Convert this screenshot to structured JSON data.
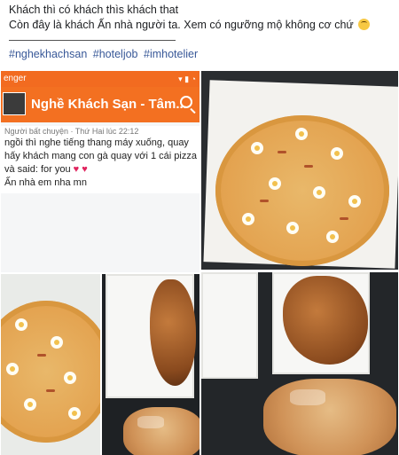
{
  "post": {
    "line1": "Khách thì có khách thìs khách that",
    "line2": "Còn đây là khách Ấn nhà người ta. Xem có ngưỡng mộ không cơ chứ",
    "hashtags": [
      "#nghekhachsan",
      "#hoteljob",
      "#imhotelier"
    ]
  },
  "phone": {
    "status_left": "enger",
    "status_right": "▾ ▮ ◔",
    "app_title": "Nghề Khách Sạn - Tâm...",
    "meta": "Người bất chuyện · Thứ Hai lúc 22:12",
    "lines": [
      "ngồi thì nghe tiếng thang máy xuống, quay",
      "hấy khách mang con gà quay với 1 cái pizza",
      "và said: for you",
      "Ấn nhà em nha mn"
    ],
    "hearts": "♥ ♥"
  },
  "photos": {
    "icon_names": [
      "pizza-photo",
      "chicken-photo",
      "bread-photo"
    ]
  }
}
